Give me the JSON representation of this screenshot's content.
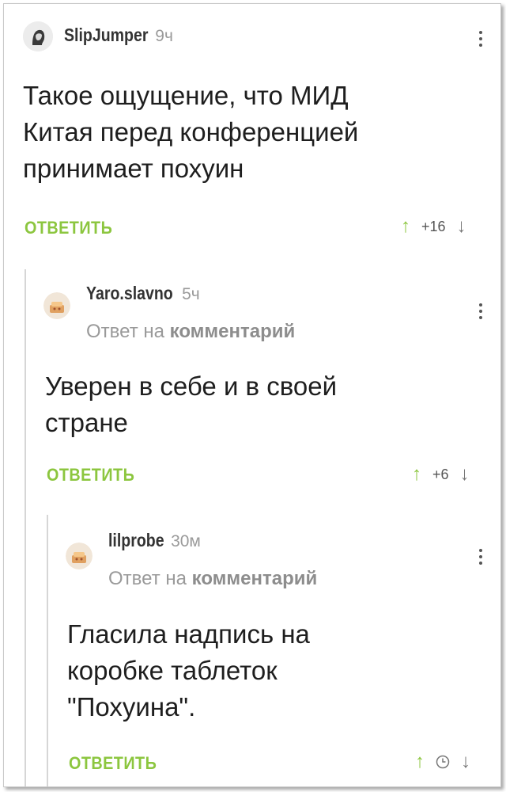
{
  "comments": [
    {
      "username": "SlipJumper",
      "time": "9ч",
      "text_lines": [
        "Такое ощущение, что МИД",
        "Китая перед конференцией",
        "принимает похуин"
      ],
      "reply_label": "ОТВЕТИТЬ",
      "score": "+16"
    },
    {
      "username": "Yaro.slavno",
      "time": "5ч",
      "reply_to_prefix": "Ответ на",
      "reply_to_target": "комментарий",
      "text_lines": [
        "Уверен в себе и в своей",
        "стране"
      ],
      "reply_label": "ОТВЕТИТЬ",
      "score": "+6"
    },
    {
      "username": "lilprobe",
      "time": "30м",
      "reply_to_prefix": "Ответ на",
      "reply_to_target": "комментарий",
      "text_lines": [
        "Гласила надпись на",
        "коробке таблеток",
        "\"Похуина\"."
      ],
      "reply_label": "ОТВЕТИТЬ"
    }
  ],
  "icons": {
    "upvote": "arrow-up-icon",
    "downvote": "arrow-down-icon",
    "pending_score": "clock-icon",
    "menu": "more-vertical-icon"
  },
  "colors": {
    "accent_green": "#8cc63f",
    "muted_text": "#9a9a9a",
    "thread_line": "#d6d6d6"
  }
}
